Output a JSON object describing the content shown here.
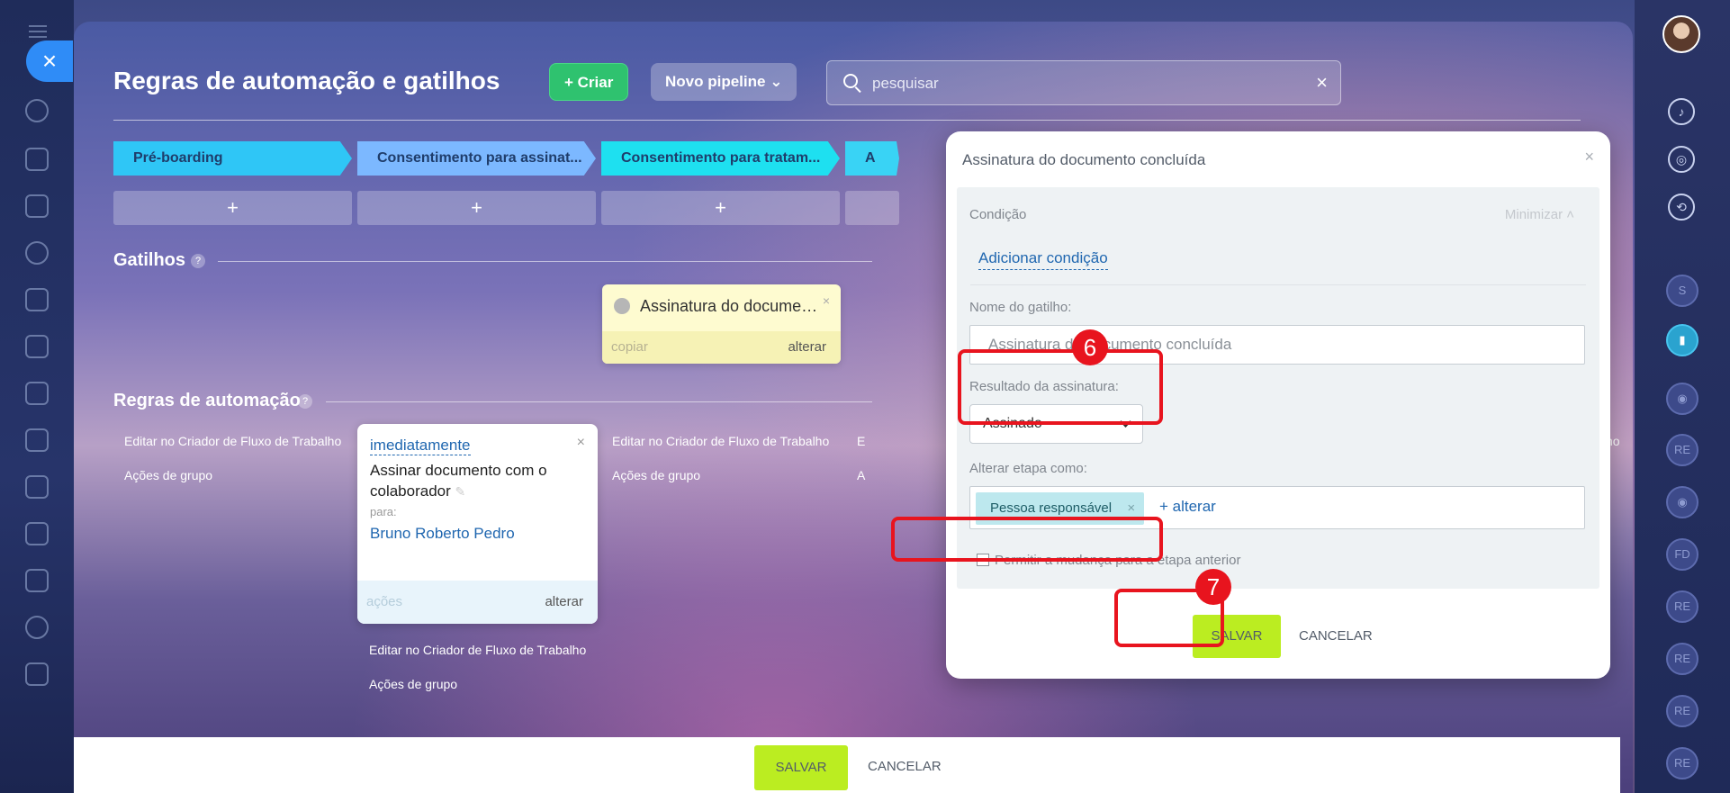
{
  "page": {
    "title": "Regras de automação e gatilhos",
    "create_label": "Criar",
    "pipeline_label": "Novo pipeline",
    "search_placeholder": "pesquisar"
  },
  "stages": [
    {
      "label": "Pré-boarding",
      "color": "#2fc6f6"
    },
    {
      "label": "Consentimento para assinat...",
      "color": "#7cb8ff"
    },
    {
      "label": "Consentimento para tratam...",
      "color": "#1ee0f0"
    },
    {
      "label": "A",
      "color": "#39d3f5"
    }
  ],
  "add_label": "+",
  "sections": {
    "triggers": "Gatilhos",
    "rules": "Regras de automação",
    "help": "?"
  },
  "trigger_card": {
    "title": "Assinatura do documen...",
    "copy": "copiar",
    "edit": "alterar"
  },
  "group_links": {
    "edit_in_designer": "Editar no Criador de Fluxo de Trabalho",
    "group_actions": "Ações de grupo",
    "partial_e": "E",
    "partial_a": "A",
    "partial_ho": "ho"
  },
  "robot_card": {
    "delay": "imediatamente",
    "title": "Assinar documento com o colaborador",
    "for_label": "para:",
    "person": "Bruno Roberto Pedro",
    "actions": "ações",
    "edit": "alterar"
  },
  "bottom_bar": {
    "save": "SALVAR",
    "cancel": "CANCELAR"
  },
  "modal": {
    "title": "Assinatura do documento concluída",
    "condition_label": "Condição",
    "minimize": "Minimizar",
    "add_condition": "Adicionar condição",
    "trigger_name_label": "Nome do gatilho:",
    "trigger_name_value": "Assinatura do documento concluída",
    "signature_result_label": "Resultado da assinatura:",
    "signature_result_value": "Assinado",
    "change_stage_label": "Alterar etapa como:",
    "responsible_tag": "Pessoa responsável",
    "change_link": "+ alterar",
    "allow_previous": "Permitir a mudança para a etapa anterior",
    "save": "SALVAR",
    "cancel": "CANCELAR"
  },
  "markers": {
    "step6": "6",
    "step7": "7"
  },
  "right_rail": {
    "avatars": [
      "S",
      "RE",
      "FD",
      "RE",
      "RE",
      "RE"
    ]
  },
  "colors": {
    "accent_green": "#bbed21",
    "create_green": "#2fc26f",
    "highlight_red": "#e8141e",
    "link_blue": "#2067b0"
  }
}
